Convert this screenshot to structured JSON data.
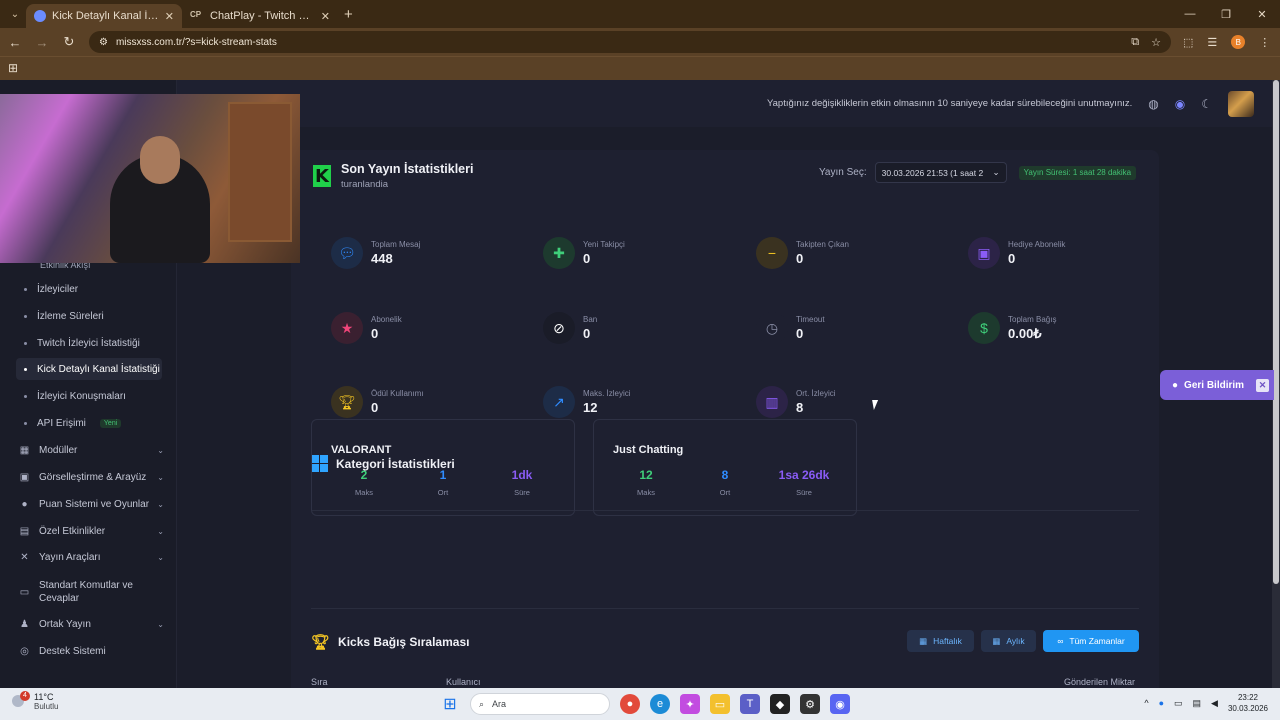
{
  "browser": {
    "tabs": [
      {
        "title": "Kick Detaylı Kanal İstatistiği - M",
        "active": true
      },
      {
        "title": "ChatPlay - Twitch & Kick İzleyic",
        "active": false
      }
    ],
    "tab2_favicon": "CP",
    "url": "missxss.com.tr/?s=kick-stream-stats",
    "profile_letter": "B"
  },
  "topbar": {
    "notice": "Yaptığınız değişikliklerin etkin olmasının 10 saniyeye kadar sürebileceğini unutmayınız."
  },
  "sidebar": {
    "cut_item": "Etkinlik Akışı",
    "sub_items": [
      {
        "label": "İzleyiciler"
      },
      {
        "label": "İzleme Süreleri"
      },
      {
        "label": "Twitch İzleyici İstatistiği"
      },
      {
        "label": "Kick Detaylı Kanal İstatistiği",
        "active": true
      },
      {
        "label": "İzleyici Konuşmaları"
      },
      {
        "label": "API Erişimi",
        "badge": "Yeni"
      }
    ],
    "main_items": [
      {
        "label": "Modüller",
        "icon": "grid-icon",
        "chevron": true
      },
      {
        "label": "Görselleştirme & Arayüz",
        "icon": "calendar-icon",
        "chevron": true
      },
      {
        "label": "Puan Sistemi ve Oyunlar",
        "icon": "coins-icon",
        "chevron": true
      },
      {
        "label": "Özel Etkinlikler",
        "icon": "gift-icon",
        "chevron": true
      },
      {
        "label": "Yayın Araçları",
        "icon": "tools-icon",
        "chevron": true
      },
      {
        "label": "Standart Komutlar ve Cevaplar",
        "icon": "keyboard-icon",
        "chevron": false
      },
      {
        "label": "Ortak Yayın",
        "icon": "users-icon",
        "chevron": true
      },
      {
        "label": "Destek Sistemi",
        "icon": "support-icon",
        "chevron": false
      }
    ]
  },
  "stream_stats": {
    "title": "Son Yayın İstatistikleri",
    "channel": "turanlandia",
    "select_label": "Yayın Seç:",
    "select_value": "30.03.2026 21:53 (1 saat 2",
    "duration_badge": "Yayın Süresi: 1 saat 28 dakika",
    "items": [
      {
        "label": "Toplam Mesaj",
        "value": "448",
        "icon": "chat-icon",
        "color": "#2f8cff",
        "bg": "#1d2c47"
      },
      {
        "label": "Yeni Takipçi",
        "value": "0",
        "icon": "user-plus-icon",
        "color": "#3fcf7a",
        "bg": "#1d3a2e"
      },
      {
        "label": "Takipten Çıkan",
        "value": "0",
        "icon": "user-minus-icon",
        "color": "#f5c623",
        "bg": "#3a3220"
      },
      {
        "label": "Hediye Abonelik",
        "value": "0",
        "icon": "gift-icon",
        "color": "#8a5cf6",
        "bg": "#2c2347"
      },
      {
        "label": "Abonelik",
        "value": "0",
        "icon": "star-icon",
        "color": "#f0457a",
        "bg": "#3a2030"
      },
      {
        "label": "Ban",
        "value": "0",
        "icon": "ban-icon",
        "color": "#ffffff",
        "bg": "#1a1c28"
      },
      {
        "label": "Timeout",
        "value": "0",
        "icon": "clock-icon",
        "color": "#8a8ea6",
        "bg": "#1e2030"
      },
      {
        "label": "Toplam Bağış",
        "value": "0.00₺",
        "icon": "dollar-icon",
        "color": "#3fcf7a",
        "bg": "#1d3a2e"
      },
      {
        "label": "Ödül Kullanımı",
        "value": "0",
        "icon": "trophy-icon",
        "color": "#f5c623",
        "bg": "#3a3220"
      },
      {
        "label": "Maks. İzleyici",
        "value": "12",
        "icon": "chart-line-icon",
        "color": "#2f8cff",
        "bg": "#1d2c47"
      },
      {
        "label": "Ort. İzleyici",
        "value": "8",
        "icon": "chart-bar-icon",
        "color": "#8a5cf6",
        "bg": "#2c2347"
      }
    ]
  },
  "categories": {
    "title": "Kategori İstatistikleri",
    "cards": [
      {
        "name": "VALORANT",
        "max": "2",
        "avg": "1",
        "duration": "1dk"
      },
      {
        "name": "Just Chatting",
        "max": "12",
        "avg": "8",
        "duration": "1sa 26dk"
      }
    ],
    "labels": {
      "max": "Maks",
      "avg": "Ort",
      "duration": "Süre"
    }
  },
  "kicks": {
    "title": "Kicks Bağış Sıralaması",
    "buttons": {
      "weekly": "Haftalık",
      "monthly": "Aylık",
      "all_time": "Tüm Zamanlar"
    },
    "columns": {
      "rank": "Sıra",
      "user": "Kullanıcı",
      "amount": "Gönderilen Miktar"
    }
  },
  "feedback": {
    "label": "Geri Bildirim",
    "close": "✕"
  },
  "taskbar": {
    "weather_temp": "11°C",
    "weather_desc": "Bulutlu",
    "notification_count": "4",
    "search_placeholder": "Ara",
    "time": "23:22",
    "date": "30.03.2026"
  },
  "colors": {
    "max": "#3fcf7a",
    "avg": "#2f8cff",
    "duration": "#8a5cf6",
    "accent": "#2096f3"
  }
}
